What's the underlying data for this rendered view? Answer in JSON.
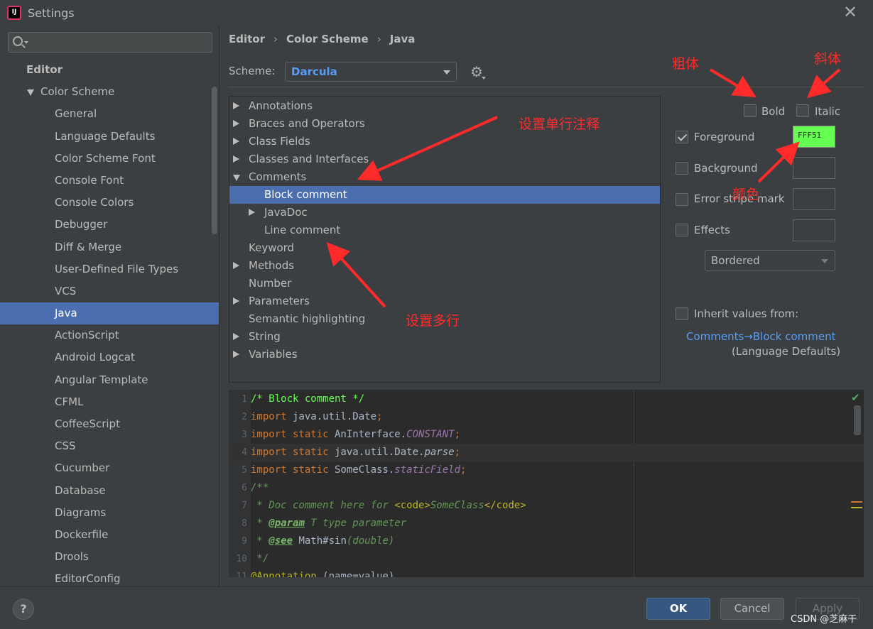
{
  "window": {
    "title": "Settings",
    "app_icon": "IJ",
    "close": "✕"
  },
  "search": {
    "placeholder": ""
  },
  "sidebar": {
    "heading": "Editor",
    "group": "Color Scheme",
    "items": [
      "General",
      "Language Defaults",
      "Color Scheme Font",
      "Console Font",
      "Console Colors",
      "Debugger",
      "Diff & Merge",
      "User-Defined File Types",
      "VCS",
      "Java",
      "ActionScript",
      "Android Logcat",
      "Angular Template",
      "CFML",
      "CoffeeScript",
      "CSS",
      "Cucumber",
      "Database",
      "Diagrams",
      "Dockerfile",
      "Drools",
      "EditorConfig"
    ],
    "selected": "Java"
  },
  "breadcrumb": [
    "Editor",
    "Color Scheme",
    "Java"
  ],
  "scheme": {
    "label": "Scheme:",
    "value": "Darcula"
  },
  "tree": {
    "items": [
      {
        "label": "Annotations",
        "level": 0,
        "expander": "collapsed"
      },
      {
        "label": "Braces and Operators",
        "level": 0,
        "expander": "collapsed"
      },
      {
        "label": "Class Fields",
        "level": 0,
        "expander": "collapsed"
      },
      {
        "label": "Classes and Interfaces",
        "level": 0,
        "expander": "collapsed"
      },
      {
        "label": "Comments",
        "level": 0,
        "expander": "expanded"
      },
      {
        "label": "Block comment",
        "level": 1,
        "expander": "none",
        "selected": true
      },
      {
        "label": "JavaDoc",
        "level": 1,
        "expander": "collapsed"
      },
      {
        "label": "Line comment",
        "level": 1,
        "expander": "none"
      },
      {
        "label": "Keyword",
        "level": 0,
        "expander": "none"
      },
      {
        "label": "Methods",
        "level": 0,
        "expander": "collapsed"
      },
      {
        "label": "Number",
        "level": 0,
        "expander": "none"
      },
      {
        "label": "Parameters",
        "level": 0,
        "expander": "collapsed"
      },
      {
        "label": "Semantic highlighting",
        "level": 0,
        "expander": "none"
      },
      {
        "label": "String",
        "level": 0,
        "expander": "collapsed"
      },
      {
        "label": "Variables",
        "level": 0,
        "expander": "collapsed"
      }
    ]
  },
  "options": {
    "bold": {
      "label": "Bold",
      "checked": false
    },
    "italic": {
      "label": "Italic",
      "checked": false
    },
    "foreground": {
      "label": "Foreground",
      "checked": true,
      "value": "FFF51",
      "color": "#64ff51"
    },
    "background": {
      "label": "Background",
      "checked": false
    },
    "error_stripe": {
      "label": "Error stripe mark",
      "checked": false
    },
    "effects": {
      "label": "Effects",
      "checked": false,
      "type": "Bordered"
    },
    "inherit": {
      "label": "Inherit values from:",
      "checked": false,
      "link": "Comments→Block comment",
      "sub": "(Language Defaults)"
    }
  },
  "preview": {
    "lines": [
      {
        "n": "1",
        "tokens": [
          {
            "t": "/* Block comment */",
            "c": "cm"
          }
        ]
      },
      {
        "n": "2",
        "tokens": [
          {
            "t": "import",
            "c": "kw"
          },
          {
            "t": " java.util.Date",
            "c": "pl"
          },
          {
            "t": ";",
            "c": "kw"
          }
        ]
      },
      {
        "n": "3",
        "tokens": [
          {
            "t": "import static",
            "c": "kw"
          },
          {
            "t": " AnInterface.",
            "c": "pl"
          },
          {
            "t": "CONSTANT",
            "c": "it"
          },
          {
            "t": ";",
            "c": "kw"
          }
        ]
      },
      {
        "n": "4",
        "current": true,
        "tokens": [
          {
            "t": "import static",
            "c": "kw"
          },
          {
            "t": " java.util.Date.",
            "c": "pl"
          },
          {
            "t": "parse",
            "c": "sta"
          },
          {
            "t": ";",
            "c": "kw"
          }
        ]
      },
      {
        "n": "5",
        "tokens": [
          {
            "t": "import static",
            "c": "kw"
          },
          {
            "t": " SomeClass.",
            "c": "pl"
          },
          {
            "t": "staticField",
            "c": "it"
          },
          {
            "t": ";",
            "c": "kw"
          }
        ]
      },
      {
        "n": "6",
        "tokens": [
          {
            "t": "/**",
            "c": "doc"
          }
        ]
      },
      {
        "n": "7",
        "tokens": [
          {
            "t": " * Doc comment here for ",
            "c": "doc"
          },
          {
            "t": "<code>",
            "c": "ann"
          },
          {
            "t": "SomeClass",
            "c": "doc"
          },
          {
            "t": "</code>",
            "c": "ann"
          }
        ]
      },
      {
        "n": "8",
        "tokens": [
          {
            "t": " * ",
            "c": "doc"
          },
          {
            "t": "@param",
            "c": "doct"
          },
          {
            "t": " T type parameter",
            "c": "doc"
          }
        ]
      },
      {
        "n": "9",
        "tokens": [
          {
            "t": " * ",
            "c": "doc"
          },
          {
            "t": "@see",
            "c": "doct"
          },
          {
            "t": " Math#sin",
            "c": "pl"
          },
          {
            "t": "(double)",
            "c": "doc"
          }
        ]
      },
      {
        "n": "10",
        "tokens": [
          {
            "t": " */",
            "c": "doc"
          }
        ]
      },
      {
        "n": "11",
        "tokens": [
          {
            "t": "@Annotation",
            "c": "ann"
          },
          {
            "t": " (name=value)",
            "c": "pl"
          }
        ]
      }
    ]
  },
  "footer": {
    "help": "?",
    "ok": "OK",
    "cancel": "Cancel",
    "apply": "Apply",
    "watermark": "CSDN @芝麻干"
  },
  "annotations": {
    "bold": "粗体",
    "italic": "斜体",
    "single_line": "设置单行注释",
    "color": "颜色",
    "multi_line": "设置多行"
  },
  "colors": {
    "accent": "#4b6eaf",
    "link": "#589df6",
    "annotation": "#ff2a2a"
  }
}
